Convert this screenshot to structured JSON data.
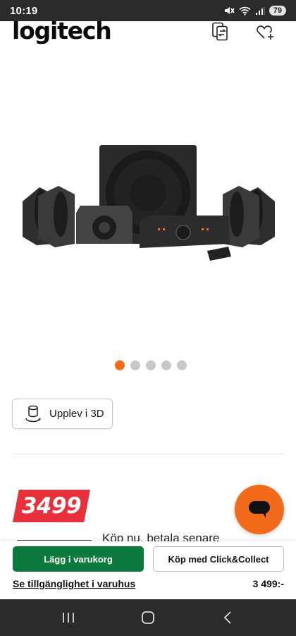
{
  "status_bar": {
    "time": "10:19",
    "battery": "79"
  },
  "header": {
    "logo": "logitech",
    "compare_icon": "compare-icon",
    "wishlist_icon": "heart-plus-icon"
  },
  "product": {
    "image_icon": "speaker-system-image"
  },
  "carousel": {
    "dot_count": 5,
    "active_index": 0,
    "accent_color": "#f26b1a"
  },
  "viewer_3d": {
    "label": "Upplev i 3D",
    "icon": "cube-3d-icon"
  },
  "price": {
    "badge": "3499",
    "badge_color": "#e8303a"
  },
  "payment": {
    "paylater_text": "Köp nu, betala senare"
  },
  "chat": {
    "icon": "chat-bubble-icon",
    "color": "#f26b1a"
  },
  "actions": {
    "add_to_cart": "Lägg i varukorg",
    "click_collect": "Köp med Click&Collect",
    "availability": "Se tillgänglighet i varuhus",
    "price": "3 499:-",
    "cart_color": "#0d7a3d"
  },
  "nav": {
    "recent": "recent-apps-icon",
    "home": "home-icon",
    "back": "back-icon"
  }
}
